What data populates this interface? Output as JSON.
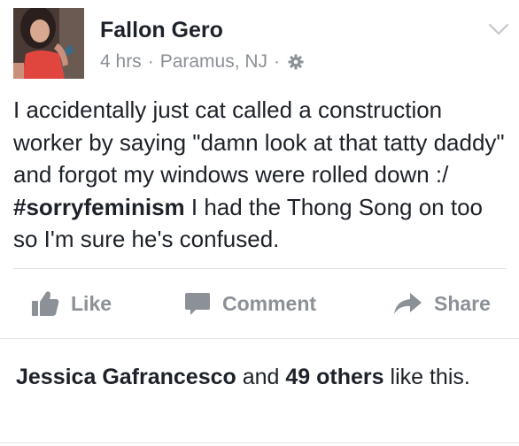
{
  "post": {
    "author": "Fallon Gero",
    "time": "4 hrs",
    "separator": "·",
    "location": "Paramus, NJ",
    "text_before_hashtag": "I accidentally just cat called a construction worker by saying \"damn look at that tatty daddy\" and forgot my windows were rolled down :/ ",
    "hashtag": "#sorryfeminism",
    "text_after_hashtag": " I had the Thong Song on too so I'm sure he's confused."
  },
  "actions": {
    "like_label": "Like",
    "comment_label": "Comment",
    "share_label": "Share"
  },
  "likes": {
    "first_name": "Jessica Gafrancesco",
    "connector": " and ",
    "others": "49 others",
    "suffix": " like this."
  },
  "icons": {
    "privacy": "gear-icon",
    "menu": "chevron-down-icon",
    "like": "thumbs-up-icon",
    "comment": "speech-bubble-icon",
    "share": "share-arrow-icon"
  },
  "colors": {
    "text": "#1d2129",
    "secondary": "#8c9197",
    "divider": "#e1e2e5"
  }
}
